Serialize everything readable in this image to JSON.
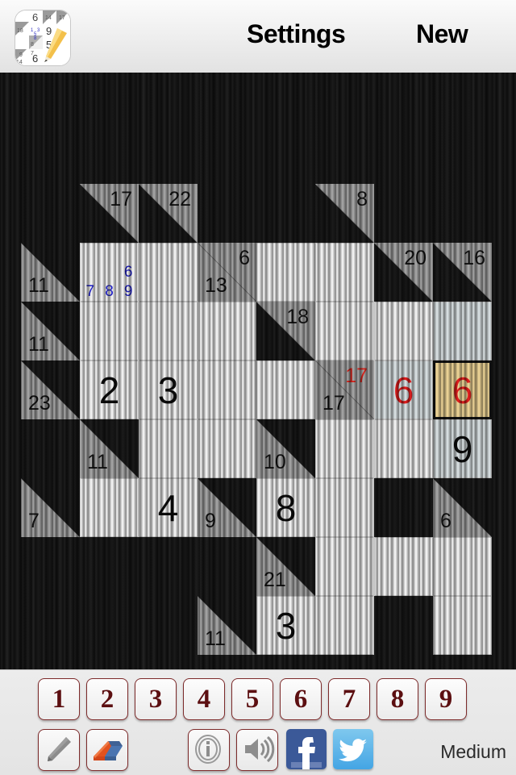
{
  "header": {
    "app_icon": "kakuro-app-icon",
    "settings_label": "Settings",
    "new_label": "New"
  },
  "board": {
    "rows": 9,
    "cols": 8,
    "cell_size": 73,
    "colors": {
      "clue_gray": "#aaaaaa",
      "cell_white": "#ffffff",
      "highlight_blue": "#e2eaec",
      "selected_gold": "#f8dd9b",
      "value_red": "#ee1c1c",
      "pencil_blue": "#1c1cd8",
      "wood_dark": "#161616"
    },
    "cells": [
      {
        "r": 0,
        "c": 1,
        "type": "clue",
        "down": "17"
      },
      {
        "r": 0,
        "c": 2,
        "type": "clue",
        "down": "22"
      },
      {
        "r": 0,
        "c": 5,
        "type": "clue",
        "down": "8"
      },
      {
        "r": 1,
        "c": 0,
        "type": "clue",
        "across": "11"
      },
      {
        "r": 1,
        "c": 1,
        "type": "cell",
        "marks": [
          "",
          "",
          "",
          "",
          "",
          "6",
          "7",
          "8",
          "9"
        ]
      },
      {
        "r": 1,
        "c": 2,
        "type": "cell"
      },
      {
        "r": 1,
        "c": 3,
        "type": "clue",
        "down": "6",
        "across": "13"
      },
      {
        "r": 1,
        "c": 4,
        "type": "cell"
      },
      {
        "r": 1,
        "c": 5,
        "type": "cell"
      },
      {
        "r": 1,
        "c": 6,
        "type": "clue",
        "down": "20"
      },
      {
        "r": 1,
        "c": 7,
        "type": "clue",
        "down": "16"
      },
      {
        "r": 2,
        "c": 0,
        "type": "clue",
        "across": "11"
      },
      {
        "r": 2,
        "c": 1,
        "type": "cell"
      },
      {
        "r": 2,
        "c": 2,
        "type": "cell"
      },
      {
        "r": 2,
        "c": 3,
        "type": "cell"
      },
      {
        "r": 2,
        "c": 4,
        "type": "clue",
        "down": "18"
      },
      {
        "r": 2,
        "c": 5,
        "type": "cell"
      },
      {
        "r": 2,
        "c": 6,
        "type": "cell"
      },
      {
        "r": 2,
        "c": 7,
        "type": "cell",
        "highlight": true
      },
      {
        "r": 3,
        "c": 0,
        "type": "clue",
        "across": "23"
      },
      {
        "r": 3,
        "c": 1,
        "type": "cell",
        "value": "2"
      },
      {
        "r": 3,
        "c": 2,
        "type": "cell",
        "value": "3"
      },
      {
        "r": 3,
        "c": 3,
        "type": "cell"
      },
      {
        "r": 3,
        "c": 4,
        "type": "cell"
      },
      {
        "r": 3,
        "c": 5,
        "type": "clue",
        "down": "17",
        "across": "17",
        "down_active": true
      },
      {
        "r": 3,
        "c": 6,
        "type": "cell",
        "value": "6",
        "value_red": true,
        "highlight": true
      },
      {
        "r": 3,
        "c": 7,
        "type": "cell",
        "value": "6",
        "value_red": true,
        "selected": true
      },
      {
        "r": 4,
        "c": 1,
        "type": "clue",
        "across": "11"
      },
      {
        "r": 4,
        "c": 2,
        "type": "cell"
      },
      {
        "r": 4,
        "c": 3,
        "type": "cell"
      },
      {
        "r": 4,
        "c": 4,
        "type": "clue",
        "across": "10"
      },
      {
        "r": 4,
        "c": 5,
        "type": "cell"
      },
      {
        "r": 4,
        "c": 6,
        "type": "cell"
      },
      {
        "r": 4,
        "c": 7,
        "type": "cell",
        "value": "9",
        "highlight": true
      },
      {
        "r": 5,
        "c": 0,
        "type": "clue",
        "across": "7"
      },
      {
        "r": 5,
        "c": 1,
        "type": "cell"
      },
      {
        "r": 5,
        "c": 2,
        "type": "cell",
        "value": "4"
      },
      {
        "r": 5,
        "c": 3,
        "type": "clue",
        "across": "9"
      },
      {
        "r": 5,
        "c": 4,
        "type": "cell",
        "value": "8"
      },
      {
        "r": 5,
        "c": 5,
        "type": "cell"
      },
      {
        "r": 5,
        "c": 7,
        "type": "clue",
        "across": "6"
      },
      {
        "r": 6,
        "c": 4,
        "type": "clue",
        "across": "21"
      },
      {
        "r": 6,
        "c": 5,
        "type": "cell"
      },
      {
        "r": 6,
        "c": 6,
        "type": "cell"
      },
      {
        "r": 6,
        "c": 7,
        "type": "cell"
      },
      {
        "r": 7,
        "c": 3,
        "type": "clue",
        "across": "11"
      },
      {
        "r": 7,
        "c": 4,
        "type": "cell",
        "value": "3"
      },
      {
        "r": 7,
        "c": 5,
        "type": "cell"
      },
      {
        "r": 7,
        "c": 7,
        "type": "cell"
      }
    ]
  },
  "toolbar": {
    "numbers": [
      "1",
      "2",
      "3",
      "4",
      "5",
      "6",
      "7",
      "8",
      "9"
    ],
    "tools": [
      {
        "name": "pencil-icon",
        "label": "pencil"
      },
      {
        "name": "eraser-icon",
        "label": "eraser"
      },
      {
        "name": "info-icon",
        "label": "info"
      },
      {
        "name": "sound-icon",
        "label": "sound"
      }
    ],
    "social": [
      {
        "name": "facebook-icon",
        "label": "f",
        "color": "#3b5998"
      },
      {
        "name": "twitter-icon",
        "label": "twitter",
        "color": "#55acee"
      }
    ],
    "difficulty": "Medium"
  }
}
